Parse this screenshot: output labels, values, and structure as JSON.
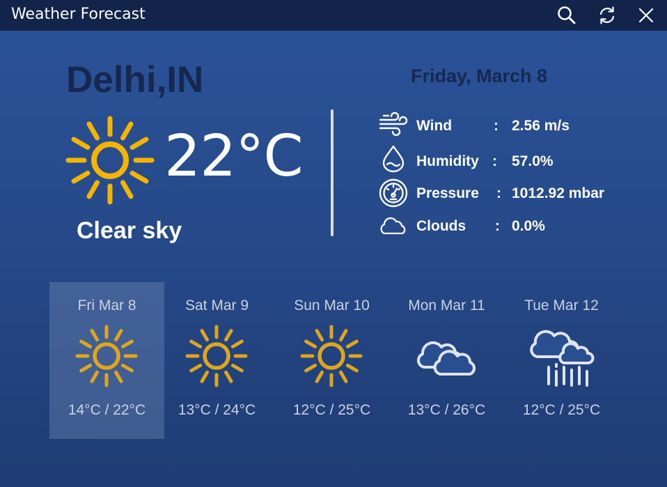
{
  "window": {
    "title": "Weather Forecast",
    "icons": [
      "search-icon",
      "refresh-icon",
      "close-icon"
    ]
  },
  "current": {
    "city": "Delhi,IN",
    "date": "Friday, March 8",
    "temperature": "22°C",
    "condition": "Clear sky",
    "icon": "sun-icon"
  },
  "stats": [
    {
      "icon": "wind-icon",
      "label": "Wind",
      "colon": ":",
      "value": "2.56 m/s"
    },
    {
      "icon": "humidity-icon",
      "label": "Humidity",
      "colon": ":",
      "value": "57.0%"
    },
    {
      "icon": "pressure-icon",
      "label": "Pressure",
      "colon": ":",
      "value": "1012.92 mbar"
    },
    {
      "icon": "cloud-icon",
      "label": "Clouds",
      "colon": ":",
      "value": "0.0%"
    }
  ],
  "forecast": [
    {
      "day": "Fri Mar 8",
      "temps": "14°C / 22°C",
      "icon": "sun-icon",
      "selected": true
    },
    {
      "day": "Sat Mar 9",
      "temps": "13°C / 24°C",
      "icon": "sun-icon",
      "selected": false
    },
    {
      "day": "Sun Mar 10",
      "temps": "12°C / 25°C",
      "icon": "sun-icon",
      "selected": false
    },
    {
      "day": "Mon Mar 11",
      "temps": "13°C / 26°C",
      "icon": "cloud-icon",
      "selected": false
    },
    {
      "day": "Tue Mar 12",
      "temps": "12°C / 25°C",
      "icon": "rain-cloud-icon",
      "selected": false
    }
  ],
  "colors": {
    "titlebar": "#13244a",
    "background_top": "#2b549a",
    "background_bottom": "#1f3c74",
    "sun_big": "#f5b400",
    "sun_small": "#e0a619",
    "dark_text": "#16284f",
    "light_text": "#c9d2e2"
  }
}
